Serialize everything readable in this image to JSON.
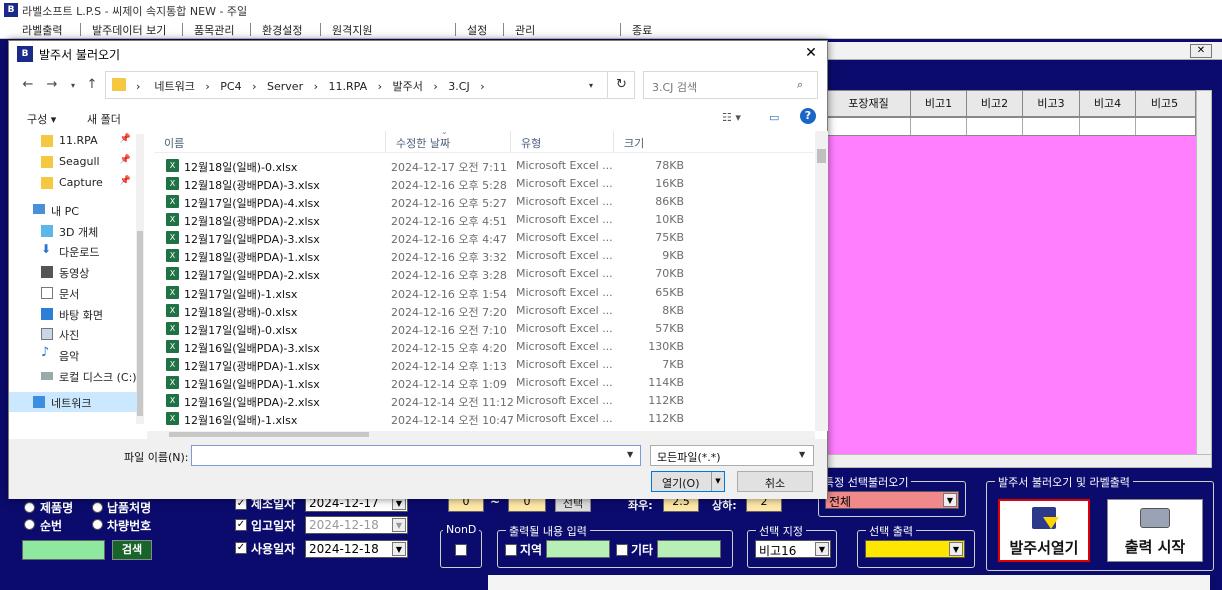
{
  "app": {
    "title": "라벨소프트 L.P.S - 씨제이 속지통합 NEW - 주일",
    "menu": [
      "라벨출력",
      "발주데이터 보기",
      "품목관리",
      "환경설정",
      "원격지원",
      "설정",
      "관리",
      "종료"
    ]
  },
  "grid": {
    "columns": [
      "포장재질",
      "비고1",
      "비고2",
      "비고3",
      "비고4",
      "비고5"
    ]
  },
  "panels": {
    "left": {
      "radio1": "제품명",
      "radio2": "납품처명",
      "radio3": "순번",
      "radio4": "차량번호",
      "search_btn": "검색",
      "search_color": "#8fe89f"
    },
    "dates": {
      "top_label": "제조일자",
      "top_value": "2024-12-17",
      "in_label": "입고일자",
      "in_value": "2024-12-18",
      "use_label": "사용일자",
      "use_value": "2024-12-18"
    },
    "range": {
      "from": "0",
      "sep": "~",
      "to": "0",
      "btn": "선택"
    },
    "size": {
      "w_label": "좌우:",
      "w_value": "2.5",
      "h_label": "상하:",
      "h_value": "2"
    },
    "nond": {
      "title": "NonD"
    },
    "output_content": {
      "title": "출력될 내용 입력",
      "c1": "지역",
      "c2": "기타"
    },
    "select_spec": {
      "title": "선택 지정",
      "value": "비고16"
    },
    "select_print": {
      "title": "선택 출력",
      "color": "#ffe600"
    },
    "specific": {
      "title": "특정 선택불러오기",
      "value": "전체",
      "color": "#f08a8a"
    },
    "order": {
      "title": "발주서 불러오기 및 라벨출력",
      "open_btn": "발주서열기",
      "print_btn": "출력 시작"
    }
  },
  "dialog": {
    "title": "발주서 불러오기",
    "path": [
      "네트워크",
      "PC4",
      "Server",
      "11.RPA",
      "발주서",
      "3.CJ"
    ],
    "search_placeholder": "3.CJ 검색",
    "toolbar": {
      "organize": "구성 ▾",
      "new_folder": "새 폴더"
    },
    "nav": [
      {
        "label": "11.RPA",
        "icon": "folder-icon",
        "pin": true
      },
      {
        "label": "Seagull",
        "icon": "folder-icon",
        "pin": true
      },
      {
        "label": "Capture",
        "icon": "folder-icon",
        "pin": true
      },
      {
        "label": "내 PC",
        "icon": "pc-icon",
        "pin": false
      },
      {
        "label": "3D 개체",
        "icon": "cube-icon",
        "pin": false
      },
      {
        "label": "다운로드",
        "icon": "download-icon",
        "pin": false
      },
      {
        "label": "동영상",
        "icon": "video-icon",
        "pin": false
      },
      {
        "label": "문서",
        "icon": "document-icon",
        "pin": false
      },
      {
        "label": "바탕 화면",
        "icon": "desktop-icon",
        "pin": false
      },
      {
        "label": "사진",
        "icon": "picture-icon",
        "pin": false
      },
      {
        "label": "음악",
        "icon": "music-icon",
        "pin": false
      },
      {
        "label": "로컬 디스크 (C:)",
        "icon": "disk-icon",
        "pin": false
      },
      {
        "label": "네트워크",
        "icon": "network-icon",
        "pin": false
      }
    ],
    "columns": {
      "name": "이름",
      "date": "수정한 날짜",
      "type": "유형",
      "size": "크기"
    },
    "files": [
      {
        "name": "12월18일(일배)-0.xlsx",
        "date": "2024-12-17 오전 7:11",
        "type": "Microsoft Excel ...",
        "size": "78KB"
      },
      {
        "name": "12월18일(광배PDA)-3.xlsx",
        "date": "2024-12-16 오후 5:28",
        "type": "Microsoft Excel ...",
        "size": "16KB"
      },
      {
        "name": "12월17일(일배PDA)-4.xlsx",
        "date": "2024-12-16 오후 5:27",
        "type": "Microsoft Excel ...",
        "size": "86KB"
      },
      {
        "name": "12월18일(광배PDA)-2.xlsx",
        "date": "2024-12-16 오후 4:51",
        "type": "Microsoft Excel ...",
        "size": "10KB"
      },
      {
        "name": "12월17일(일배PDA)-3.xlsx",
        "date": "2024-12-16 오후 4:47",
        "type": "Microsoft Excel ...",
        "size": "75KB"
      },
      {
        "name": "12월18일(광배PDA)-1.xlsx",
        "date": "2024-12-16 오후 3:32",
        "type": "Microsoft Excel ...",
        "size": "9KB"
      },
      {
        "name": "12월17일(일배PDA)-2.xlsx",
        "date": "2024-12-16 오후 3:28",
        "type": "Microsoft Excel ...",
        "size": "70KB"
      },
      {
        "name": "12월17일(일배)-1.xlsx",
        "date": "2024-12-16 오후 1:54",
        "type": "Microsoft Excel ...",
        "size": "65KB"
      },
      {
        "name": "12월18일(광배)-0.xlsx",
        "date": "2024-12-16 오전 7:20",
        "type": "Microsoft Excel ...",
        "size": "8KB"
      },
      {
        "name": "12월17일(일배)-0.xlsx",
        "date": "2024-12-16 오전 7:10",
        "type": "Microsoft Excel ...",
        "size": "57KB"
      },
      {
        "name": "12월16일(일배PDA)-3.xlsx",
        "date": "2024-12-15 오후 4:20",
        "type": "Microsoft Excel ...",
        "size": "130KB"
      },
      {
        "name": "12월17일(광배PDA)-1.xlsx",
        "date": "2024-12-14 오후 1:13",
        "type": "Microsoft Excel ...",
        "size": "7KB"
      },
      {
        "name": "12월16일(일배PDA)-1.xlsx",
        "date": "2024-12-14 오후 1:09",
        "type": "Microsoft Excel ...",
        "size": "114KB"
      },
      {
        "name": "12월16일(일배PDA)-2.xlsx",
        "date": "2024-12-14 오전 11:12",
        "type": "Microsoft Excel ...",
        "size": "112KB"
      },
      {
        "name": "12월16일(일배)-1.xlsx",
        "date": "2024-12-14 오전 10:47",
        "type": "Microsoft Excel ...",
        "size": "112KB"
      }
    ],
    "filename_label": "파일 이름(N):",
    "filename_value": "",
    "filetype": "모든파일(*.*)",
    "open_btn": "열기(O)",
    "cancel_btn": "취소"
  }
}
